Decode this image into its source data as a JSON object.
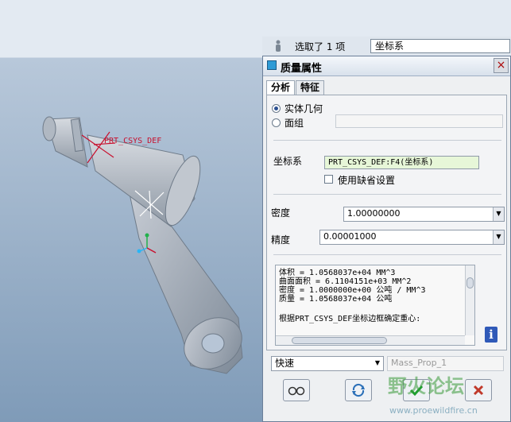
{
  "toolbar": {
    "selection_status": "选取了 1 项",
    "filter_value": "坐标系"
  },
  "viewport": {
    "csys_label": "PRT_CSYS_DEF"
  },
  "dialog": {
    "title": "质量属性",
    "close_label": "×",
    "tabs": [
      {
        "label": "分析"
      },
      {
        "label": "特征"
      }
    ],
    "geometry": {
      "solid_label": "实体几何",
      "quilt_label": "面组",
      "quilt_value": ""
    },
    "csys": {
      "label": "坐标系",
      "value": "PRT_CSYS_DEF:F4(坐标系)",
      "use_default_label": "使用缺省设置"
    },
    "density": {
      "label": "密度",
      "value": "1.00000000"
    },
    "accuracy": {
      "label": "精度",
      "value": "0.00001000"
    },
    "results": [
      "体积 =  1.0568037e+04  MM^3",
      "曲面面积 =  6.1104151e+03  MM^2",
      "密度 =  1.0000000e+00 公吨 / MM^3",
      "质量 =  1.0568037e+04 公吨",
      "",
      "根据PRT_CSYS_DEF坐标边框确定重心:"
    ],
    "mode": {
      "value": "快速"
    },
    "feature_name": {
      "value": "Mass_Prop_1"
    },
    "buttons": {
      "preview_icon": "glasses-icon",
      "repeat_icon": "repeat-icon",
      "ok_icon": "check-icon",
      "cancel_icon": "x-icon"
    }
  },
  "watermark": {
    "text": "野火论坛",
    "url": "www.proewildfire.cn"
  },
  "colors": {
    "accent": "#2f59b8",
    "csys_red": "#c8102e",
    "field_green": "#e7f7d8"
  }
}
